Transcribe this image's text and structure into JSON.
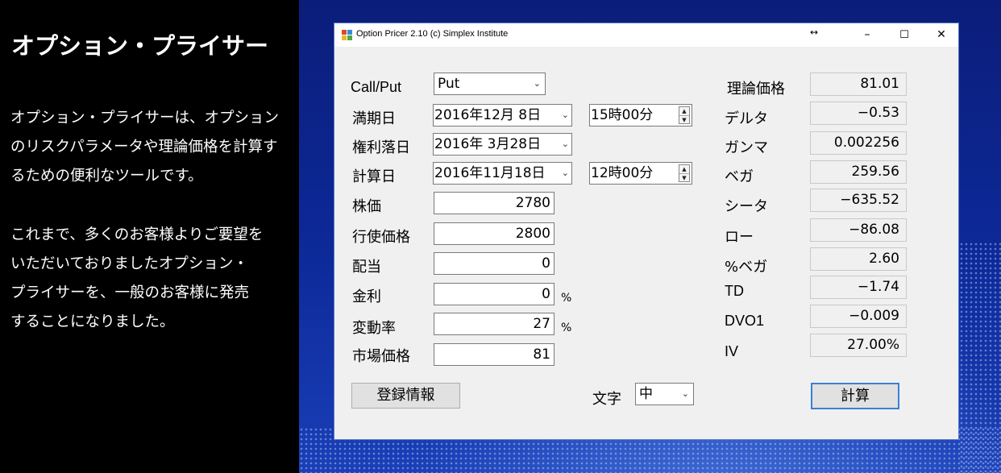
{
  "promo": {
    "title": "オプション・プライサー",
    "lines": [
      "オプション・プライサーは、オプション",
      "のリスクパラメータや理論価格を計算す",
      "るための便利なツールです。",
      "これまで、多くのお客様よりご要望を",
      "いただいておりましたオプション・",
      "プライサーを、一般のお客様に発売",
      "することになりました。"
    ]
  },
  "window": {
    "title": "Option Pricer 2.10  (c) Simplex Institute",
    "resize_glyph": "↔",
    "minimize": "–",
    "maximize": "☐",
    "close": "✕"
  },
  "inputs": {
    "callput": {
      "label": "Call/Put",
      "value": "Put"
    },
    "expiry": {
      "label": "満期日",
      "date": "2016年12月 8日",
      "time": "15時00分"
    },
    "exdiv": {
      "label": "権利落日",
      "date": "2016年 3月28日"
    },
    "calcdate": {
      "label": "計算日",
      "date": "2016年11月18日",
      "time": "12時00分"
    },
    "spot": {
      "label": "株価",
      "value": "2780"
    },
    "strike": {
      "label": "行使価格",
      "value": "2800"
    },
    "dividend": {
      "label": "配当",
      "value": "0"
    },
    "rate": {
      "label": "金利",
      "value": "0",
      "unit": "%"
    },
    "vol": {
      "label": "変動率",
      "value": "27",
      "unit": "%"
    },
    "market": {
      "label": "市場価格",
      "value": "81"
    }
  },
  "outputs": [
    {
      "label": "理論価格",
      "value": "81.01"
    },
    {
      "label": "デルタ",
      "value": "−0.53"
    },
    {
      "label": "ガンマ",
      "value": "0.002256"
    },
    {
      "label": "ベガ",
      "value": "259.56"
    },
    {
      "label": "シータ",
      "value": "−635.52"
    },
    {
      "label": "ロー",
      "value": "−86.08"
    },
    {
      "label": "%ベガ",
      "value": "2.60"
    },
    {
      "label": "TD",
      "value": "−1.74"
    },
    {
      "label": "DVO1",
      "value": "−0.009"
    },
    {
      "label": "IV",
      "value": "27.00%"
    }
  ],
  "footer": {
    "register_label": "登録情報",
    "font_label": "文字",
    "font_size_value": "中",
    "calc_label": "計算"
  },
  "colors": {
    "window_border": "#5a7ac8",
    "calc_focus_border": "#3c7fd8",
    "background_blue": "#0d2a9a"
  }
}
